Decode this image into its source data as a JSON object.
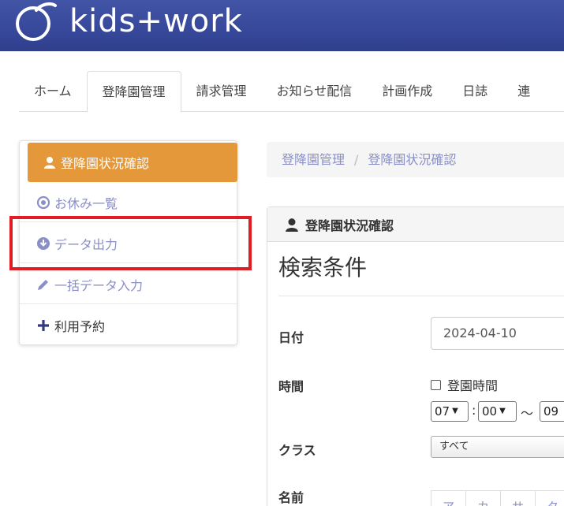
{
  "header": {
    "logo_text": "kids+work",
    "logo_icon": "logo-mark-icon",
    "bg_color": "#3a4c9c"
  },
  "tabs": [
    {
      "label": "ホーム"
    },
    {
      "label": "登降園管理",
      "active": true
    },
    {
      "label": "請求管理"
    },
    {
      "label": "お知らせ配信"
    },
    {
      "label": "計画作成"
    },
    {
      "label": "日誌"
    },
    {
      "label": "連"
    }
  ],
  "sidebar": {
    "items": [
      {
        "label": "登降園状況確認",
        "icon": "user-icon",
        "active": true
      },
      {
        "label": "お休み一覧",
        "icon": "dot-circle-icon"
      },
      {
        "label": "データ出力",
        "icon": "download-circle-icon"
      },
      {
        "label": "一括データ入力",
        "icon": "pencil-icon"
      },
      {
        "label": "利用予約",
        "icon": "plus-icon"
      }
    ],
    "accent_color": "#e4983a",
    "highlight_color": "#e01d23"
  },
  "breadcrumb": {
    "items": [
      "登降園管理",
      "登降園状況確認"
    ],
    "separator": "/"
  },
  "panel": {
    "heading": "登降園状況確認",
    "search_title": "検索条件",
    "date_label": "日付",
    "date_value": "2024-04-10",
    "time_label": "時間",
    "time_checkbox_label": "登園時間",
    "time_hour": "07",
    "time_minute": "00",
    "time_separator": ":",
    "time_range_sep": "～",
    "time_to_hour": "09",
    "class_label": "クラス",
    "class_value": "すべて",
    "name_label": "名前",
    "kana": [
      "ア",
      "カ",
      "サ",
      "タ"
    ]
  }
}
